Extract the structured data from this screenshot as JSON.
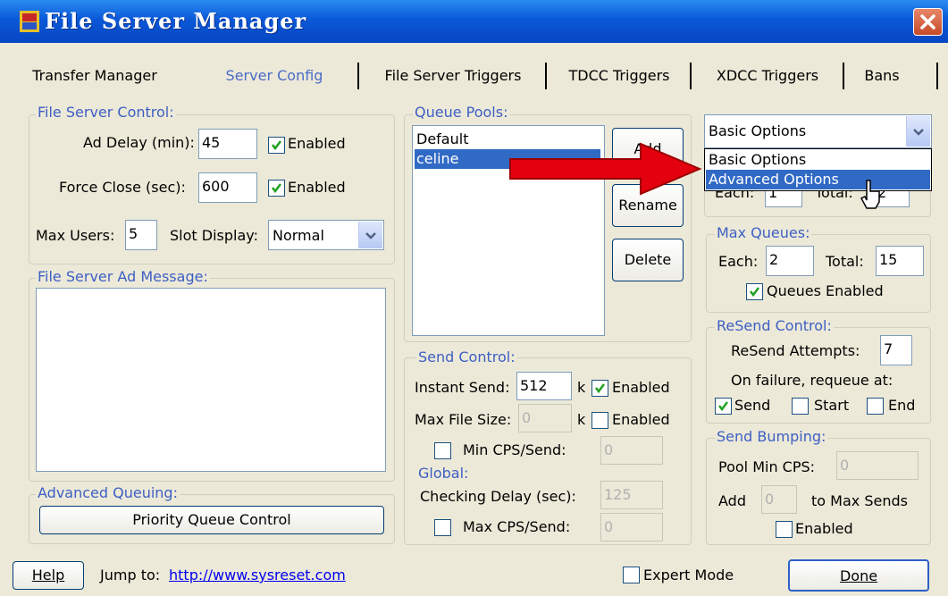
{
  "window": {
    "title": "File Server Manager"
  },
  "tabs": [
    {
      "label": "Transfer Manager"
    },
    {
      "label": "Server Config"
    },
    {
      "label": "File Server Triggers"
    },
    {
      "label": "TDCC Triggers"
    },
    {
      "label": "XDCC Triggers"
    },
    {
      "label": "Bans"
    }
  ],
  "active_tab": "Server Config",
  "file_server_control": {
    "legend": "File Server Control:",
    "ad_delay_label": "Ad Delay (min):",
    "ad_delay_value": "45",
    "ad_delay_enabled_label": "Enabled",
    "force_close_label": "Force Close (sec):",
    "force_close_value": "600",
    "force_close_enabled_label": "Enabled",
    "max_users_label": "Max Users:",
    "max_users_value": "5",
    "slot_display_label": "Slot Display:",
    "slot_display_value": "Normal"
  },
  "ad_message": {
    "legend": "File Server Ad Message:",
    "value": ""
  },
  "advanced_queuing": {
    "legend": "Advanced Queuing:",
    "button_label": "Priority Queue Control"
  },
  "queue_pools": {
    "legend": "Queue Pools:",
    "items": [
      "Default",
      "celine"
    ],
    "selected": "celine",
    "add_label": "Add",
    "rename_label": "Rename",
    "delete_label": "Delete"
  },
  "send_control": {
    "legend": "Send Control:",
    "instant_send_label": "Instant Send:",
    "instant_send_value": "512",
    "instant_send_unit": "k",
    "instant_send_enabled_label": "Enabled",
    "max_file_size_label": "Max File Size:",
    "max_file_size_value": "0",
    "max_file_size_unit": "k",
    "max_file_size_enabled_label": "Enabled",
    "min_cps_label": "Min CPS/Send:",
    "min_cps_value": "0"
  },
  "global": {
    "legend": "Global:",
    "checking_delay_label": "Checking Delay (sec):",
    "checking_delay_value": "125",
    "max_cps_label": "Max CPS/Send:",
    "max_cps_value": "0"
  },
  "options_combo": {
    "value": "Basic Options",
    "options": [
      "Basic Options",
      "Advanced Options"
    ],
    "highlighted": "Advanced Options"
  },
  "hidden_row": {
    "each_label": "Each:",
    "each_value": "1",
    "total_label": "Total:",
    "total_value": "2"
  },
  "max_queues": {
    "legend": "Max Queues:",
    "each_label": "Each:",
    "each_value": "2",
    "total_label": "Total:",
    "total_value": "15",
    "enabled_label": "Queues Enabled"
  },
  "resend_control": {
    "legend": "ReSend Control:",
    "attempts_label": "ReSend Attempts:",
    "attempts_value": "7",
    "requeue_label": "On failure, requeue at:",
    "send_label": "Send",
    "start_label": "Start",
    "end_label": "End"
  },
  "send_bumping": {
    "legend": "Send Bumping:",
    "pool_min_label": "Pool Min CPS:",
    "pool_min_value": "0",
    "add_label": "Add",
    "add_value": "0",
    "to_max_label": "to Max Sends",
    "enabled_label": "Enabled"
  },
  "footer": {
    "help_label": "Help",
    "jump_label": "Jump to:",
    "link_text": "http://www.sysreset.com",
    "expert_label": "Expert Mode",
    "done_label": "Done"
  },
  "colors": {
    "titlebar": "#0a58d8",
    "legend": "#3d5fc4",
    "selection": "#316ac5",
    "arrow": "#e3000f",
    "face": "#ece9d8"
  }
}
